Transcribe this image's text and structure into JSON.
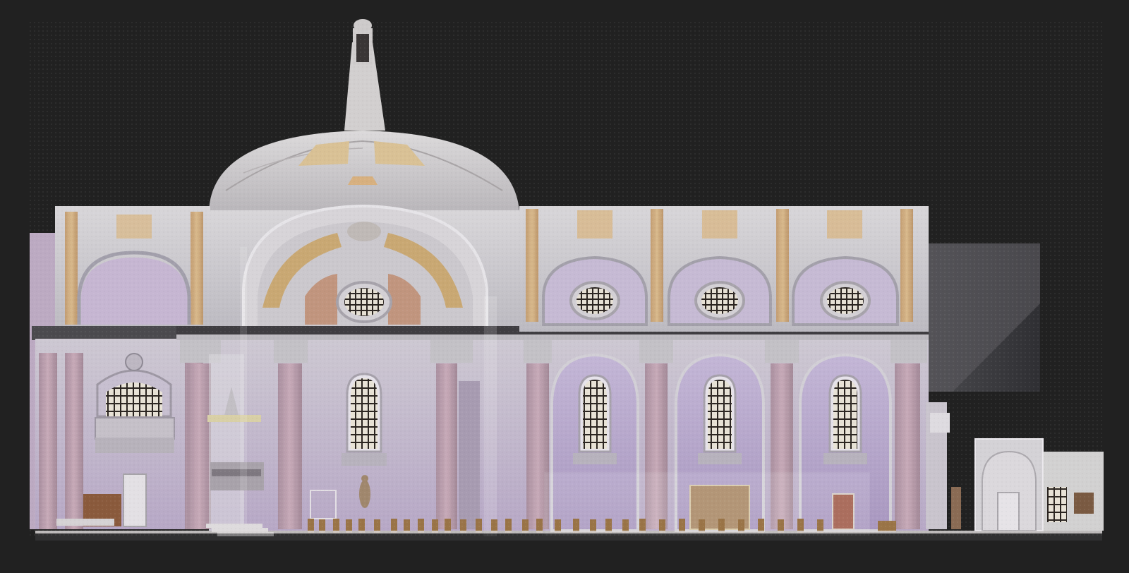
{
  "image": {
    "kind": "church-section-point-cloud",
    "description_visible_text": []
  },
  "colors": {
    "background": "#212121",
    "wall_lavender": "#b6a6c8",
    "wall_grey": "#c4c2c6",
    "dome": "#cfcdcf",
    "ochre": "#c9a873",
    "marble_pink": "#b899a7",
    "window_dark": "#2a2420",
    "pew_wood": "#9a7447",
    "floor": "#d9d6d6"
  }
}
